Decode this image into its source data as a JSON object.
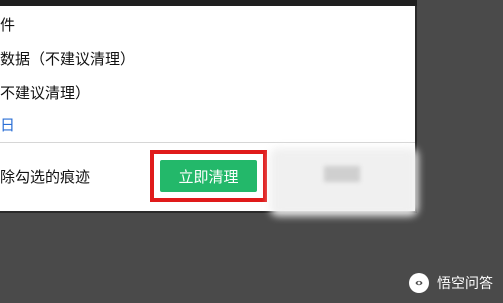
{
  "dialog": {
    "rows": [
      {
        "label": "件"
      },
      {
        "label": "数据（不建议清理）"
      },
      {
        "label": "不建议清理）"
      }
    ],
    "link_label": "日"
  },
  "footer": {
    "text": "除勾选的痕迹",
    "clean_button_label": "立即清理"
  },
  "watermark": {
    "label": "悟空问答",
    "icon": "wukong-icon"
  },
  "colors": {
    "accent_green": "#23b86a",
    "highlight_red": "#e01a1a",
    "link_blue": "#2b6fd6",
    "backdrop": "#4a4a4a"
  }
}
